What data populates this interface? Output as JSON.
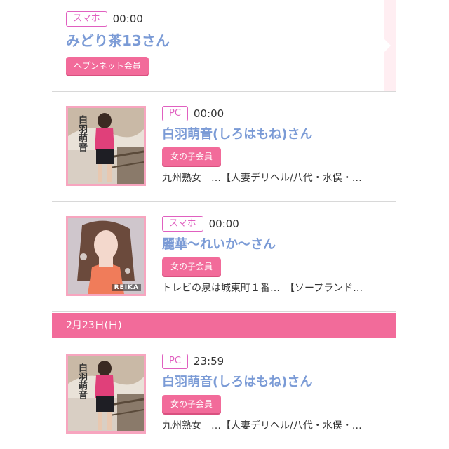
{
  "colors": {
    "accent_pink": "#f26b9a",
    "name_blue": "#7b9bd6",
    "device_tag_border": "#e060c0"
  },
  "entries": [
    {
      "device": "スマホ",
      "time": "00:00",
      "name": "みどり茶13さん",
      "badge": "ヘブンネット会員"
    },
    {
      "device": "PC",
      "time": "00:00",
      "name": "白羽萌音(しろはもね)さん",
      "badge": "女の子会員",
      "shop": "九州熟女　…【人妻デリヘル/八代・水俣・…",
      "photo_text": "白羽萌音"
    },
    {
      "device": "スマホ",
      "time": "00:00",
      "name": "麗華〜れいか〜さん",
      "badge": "女の子会員",
      "shop": "トレビの泉は城東町１番…　【ソープランド…",
      "photo_text": "REIKA"
    },
    {
      "device": "PC",
      "time": "23:59",
      "name": "白羽萌音(しろはもね)さん",
      "badge": "女の子会員",
      "shop": "九州熟女　…【人妻デリヘル/八代・水俣・…",
      "photo_text": "白羽萌音"
    }
  ],
  "date_header": "2月23日(日)"
}
